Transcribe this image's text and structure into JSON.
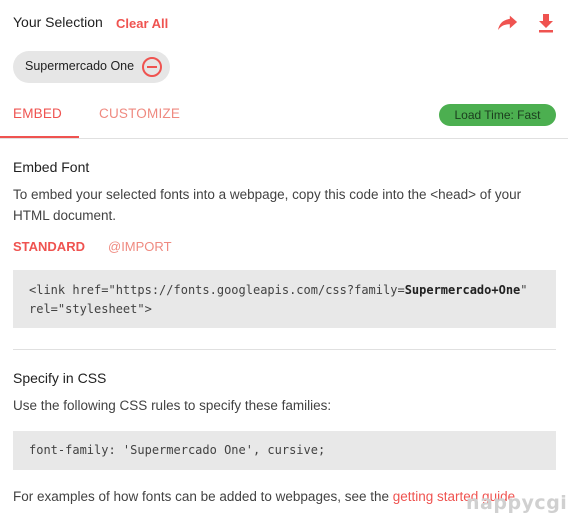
{
  "header": {
    "title": "Your Selection",
    "clear_label": "Clear All",
    "share_icon": "share-arrow-icon",
    "download_icon": "download-icon",
    "accent_color": "#ef5350"
  },
  "selection": {
    "chips": [
      {
        "label": "Supermercado One",
        "remove_icon": "remove-circle-icon"
      }
    ]
  },
  "tabs": {
    "items": [
      {
        "label": "EMBED",
        "active": true
      },
      {
        "label": "CUSTOMIZE",
        "active": false
      }
    ],
    "load_time": "Load Time: Fast",
    "load_time_color": "#4caf50"
  },
  "embed": {
    "heading": "Embed Font",
    "description": "To embed your selected fonts into a webpage, copy this code into the <head> of your HTML document.",
    "method_tabs": [
      {
        "label": "STANDARD",
        "active": true
      },
      {
        "label": "@IMPORT",
        "active": false
      }
    ],
    "code": {
      "prefix": "<link href=\"https://fonts.googleapis.com/css?family=",
      "family": "Supermercado+One",
      "suffix": "\"",
      "line2": "rel=\"stylesheet\">"
    }
  },
  "css": {
    "heading": "Specify in CSS",
    "description": "Use the following CSS rules to specify these families:",
    "rule": "font-family: 'Supermercado One', cursive;",
    "footer_text": "For examples of how fonts can be added to webpages, see the ",
    "footer_link": "getting started guide",
    "footer_end": "."
  },
  "watermark": "nappycgi"
}
